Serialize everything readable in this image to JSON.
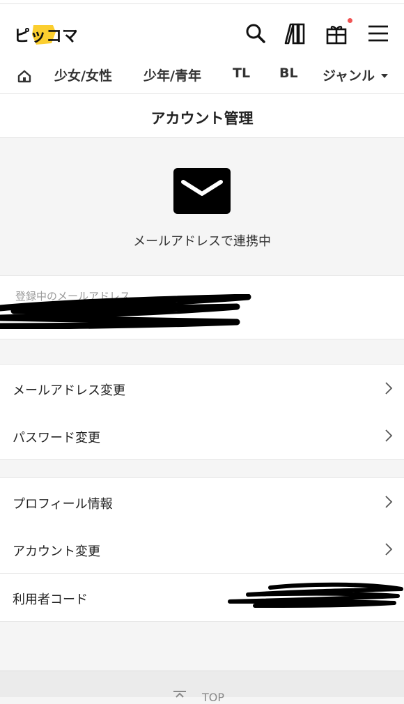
{
  "brand": {
    "logo_text": "ピッコマ",
    "accent": "#fbce2f",
    "notify_dot": "#f05454"
  },
  "header": {
    "icons": [
      "search-icon",
      "bookshelf-icon",
      "gift-icon",
      "menu-icon"
    ]
  },
  "nav": {
    "home_icon": "home-icon",
    "items": [
      "少女/女性",
      "少年/青年",
      "TL",
      "BL",
      "ジャンル"
    ]
  },
  "page": {
    "title": "アカウント管理"
  },
  "hero": {
    "icon": "mail-icon",
    "status": "メールアドレスで連携中"
  },
  "email": {
    "label": "登録中のメールアドレス"
  },
  "menu": {
    "group1": [
      "メールアドレス変更",
      "パスワード変更"
    ],
    "group2": [
      "プロフィール情報",
      "アカウント変更"
    ],
    "user_code_label": "利用者コード"
  },
  "footer": {
    "top_label": "TOP"
  }
}
